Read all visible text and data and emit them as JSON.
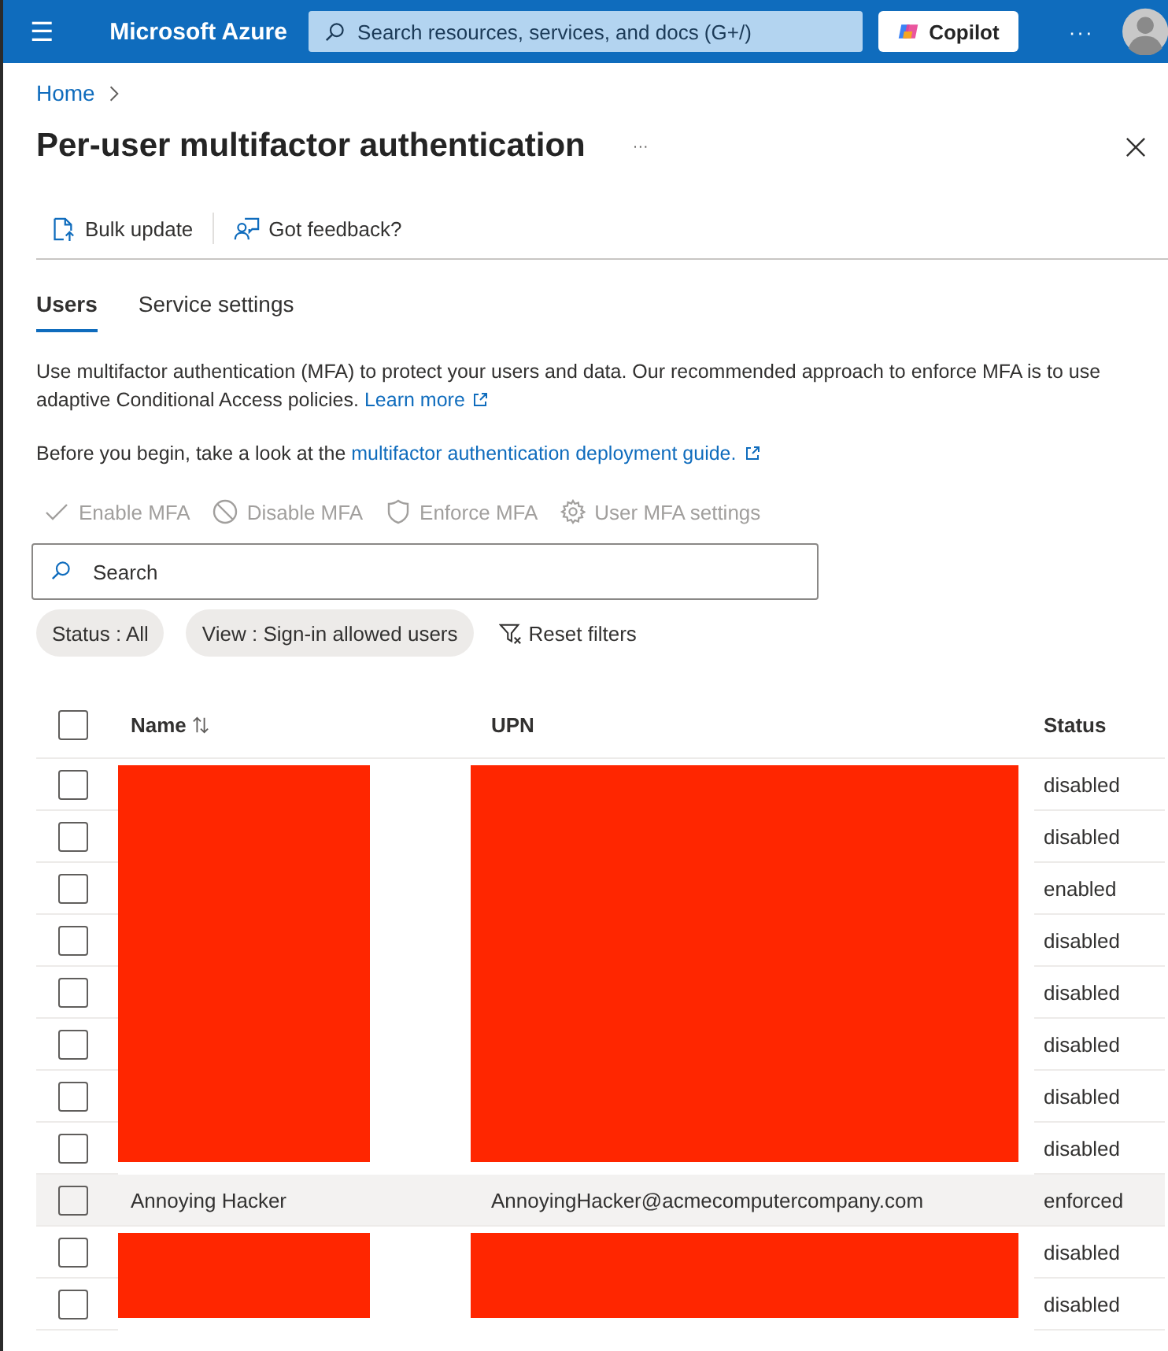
{
  "top_bar": {
    "menu_icon": "☰",
    "brand": "Microsoft Azure",
    "search": {
      "placeholder": "Search resources, services, and docs (G+/)"
    },
    "copilot_button": "Copilot",
    "more": "···"
  },
  "breadcrumb": [
    "Home"
  ],
  "page": {
    "title": "Per-user multifactor authentication",
    "more": "···"
  },
  "command_bar": [
    "Bulk update",
    "Got feedback?"
  ],
  "tabs": [
    {
      "label": "Users",
      "selected": true
    },
    {
      "label": "Service settings",
      "selected": false
    }
  ],
  "intro": {
    "text": "Use multifactor authentication (MFA) to protect your users and data. Our recommended approach to enforce MFA is to use adaptive Conditional Access policies.",
    "link": "Learn more"
  },
  "guide": {
    "text": "Before you begin, take a look at the",
    "link": "multifactor authentication deployment guide."
  },
  "actions": [
    {
      "label": "Enable MFA",
      "kind": "check",
      "disabled": true
    },
    {
      "label": "Disable MFA",
      "kind": "block",
      "disabled": true
    },
    {
      "label": "Enforce MFA",
      "kind": "shield",
      "disabled": true
    },
    {
      "label": "User MFA settings",
      "kind": "gear",
      "disabled": true
    }
  ],
  "search": {
    "placeholder": "Search"
  },
  "filters": [
    {
      "label": "Status : All",
      "kind": "pill"
    },
    {
      "label": "View : Sign-in allowed users",
      "kind": "pill"
    },
    {
      "label": "Reset filters",
      "kind": "reset"
    }
  ],
  "table": {
    "select_all_checked": false,
    "columns": [
      "Name",
      "UPN",
      "Status"
    ],
    "rows": [
      {
        "redacted": true,
        "checked": false,
        "highlighted": false,
        "status": "disabled"
      },
      {
        "redacted": true,
        "checked": false,
        "highlighted": false,
        "status": "disabled"
      },
      {
        "redacted": true,
        "checked": false,
        "highlighted": false,
        "status": "enabled"
      },
      {
        "redacted": true,
        "checked": false,
        "highlighted": false,
        "status": "disabled"
      },
      {
        "redacted": true,
        "checked": false,
        "highlighted": false,
        "status": "disabled"
      },
      {
        "redacted": true,
        "checked": false,
        "highlighted": false,
        "status": "disabled"
      },
      {
        "redacted": true,
        "checked": false,
        "highlighted": false,
        "status": "disabled"
      },
      {
        "redacted": true,
        "checked": false,
        "highlighted": false,
        "status": "disabled"
      },
      {
        "redacted": false,
        "checked": false,
        "highlighted": true,
        "name": "Annoying Hacker",
        "upn": "AnnoyingHacker@acmecomputercompany.com",
        "status": "enforced"
      },
      {
        "redacted": true,
        "checked": false,
        "highlighted": false,
        "status": "disabled"
      },
      {
        "redacted": true,
        "checked": false,
        "highlighted": false,
        "status": "disabled"
      }
    ]
  }
}
